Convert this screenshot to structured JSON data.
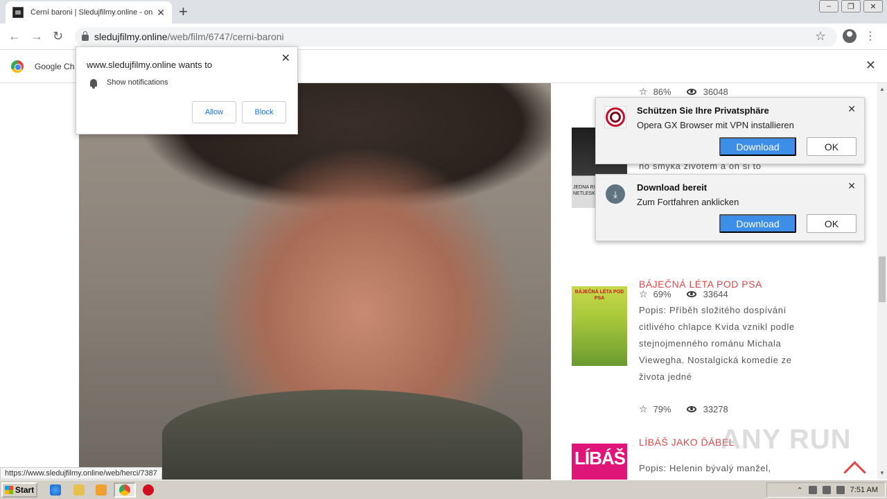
{
  "browser": {
    "tab_title": "Černí baroni | Sledujfilmy.online - on",
    "url_host": "sledujfilmy.online",
    "url_path": "/web/film/6747/cerni-baroni",
    "infobar_text": "Google Ch"
  },
  "permission_popup": {
    "title": "www.sledujfilmy.online wants to",
    "item": "Show notifications",
    "allow_label": "Allow",
    "block_label": "Block"
  },
  "ads": [
    {
      "title": "Schützen Sie Ihre Privatsphäre",
      "body": "Opera GX Browser mit VPN installieren",
      "download_label": "Download",
      "ok_label": "OK"
    },
    {
      "title": "Download bereit",
      "body": "Zum Fortfahren anklicken",
      "download_label": "Download",
      "ok_label": "OK"
    }
  ],
  "films": [
    {
      "rating": "86%",
      "views": "36048"
    },
    {
      "desc_fragment": "ho smýká životem a on si to",
      "poster_caption": "JEDNA RUKA NETLESK",
      "rating": "69%",
      "views": "33644"
    },
    {
      "title": "BÁJEČNÁ LÉTA POD PSA",
      "description": "Popis: Příběh složitého dospívání citlivého chlapce Kvida vznikl podle stejnojmenného románu Michala Viewegha. Nostalgická komedie ze života jedné",
      "poster_caption": "BÁJEČNÁ LÉTA POD PSA",
      "rating": "79%",
      "views": "33278"
    },
    {
      "title": "LÍBÁŠ JAKO ĎÁBEL",
      "description": "Popis: Helenin bývalý manžel,",
      "poster_caption": "LÍBÁŠ"
    }
  ],
  "status_url": "https://www.sledujfilmy.online/web/herci/7387",
  "watermark": "ANY RUN",
  "taskbar": {
    "start_label": "Start",
    "clock": "7:51 AM"
  },
  "colors": {
    "accent_red": "#e34545",
    "download_blue": "#3c8ee6"
  }
}
